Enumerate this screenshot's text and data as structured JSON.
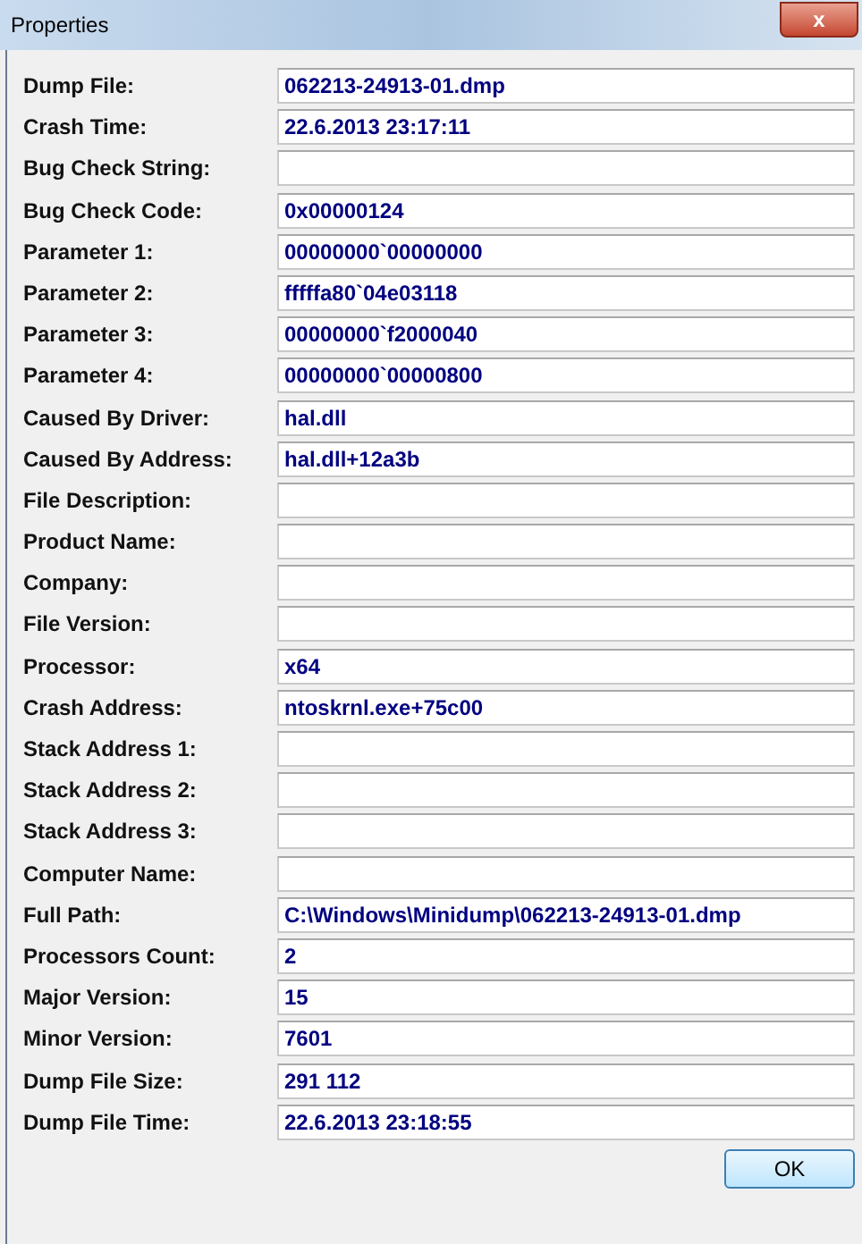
{
  "window": {
    "title": "Properties",
    "close_label": "x"
  },
  "fields": [
    {
      "label": "Dump File:",
      "value": "062213-24913-01.dmp"
    },
    {
      "label": "Crash Time:",
      "value": "22.6.2013 23:17:11"
    },
    {
      "label": "Bug Check String:"
    },
    {
      "label": "Bug Check Code:",
      "value": "0x00000124"
    },
    {
      "label": "Parameter 1:",
      "value": "00000000`00000000"
    },
    {
      "label": "Parameter 2:",
      "value": "fffffa80`04e03118"
    },
    {
      "label": "Parameter 3:",
      "value": "00000000`f2000040"
    },
    {
      "label": "Parameter 4:",
      "value": "00000000`00000800"
    },
    {
      "label": "Caused By Driver:",
      "value": "hal.dll"
    },
    {
      "label": "Caused By Address:",
      "value": "hal.dll+12a3b"
    },
    {
      "label": "File Description:"
    },
    {
      "label": "Product Name:"
    },
    {
      "label": "Company:"
    },
    {
      "label": "File Version:"
    },
    {
      "label": "Processor:",
      "value": "x64"
    },
    {
      "label": "Crash Address:",
      "value": "ntoskrnl.exe+75c00"
    },
    {
      "label": "Stack Address 1:"
    },
    {
      "label": "Stack Address 2:"
    },
    {
      "label": "Stack Address 3:"
    },
    {
      "label": "Computer Name:"
    },
    {
      "label": "Full Path:",
      "value": "C:\\Windows\\Minidump\\062213-24913-01.dmp"
    },
    {
      "label": "Processors Count:",
      "value": "2"
    },
    {
      "label": "Major Version:",
      "value": "15"
    },
    {
      "label": "Minor Version:",
      "value": "7601"
    },
    {
      "label": "Dump File Size:",
      "value": "291 112"
    },
    {
      "label": "Dump File Time:",
      "value": "22.6.2013 23:18:55"
    }
  ],
  "buttons": [
    "OK"
  ]
}
